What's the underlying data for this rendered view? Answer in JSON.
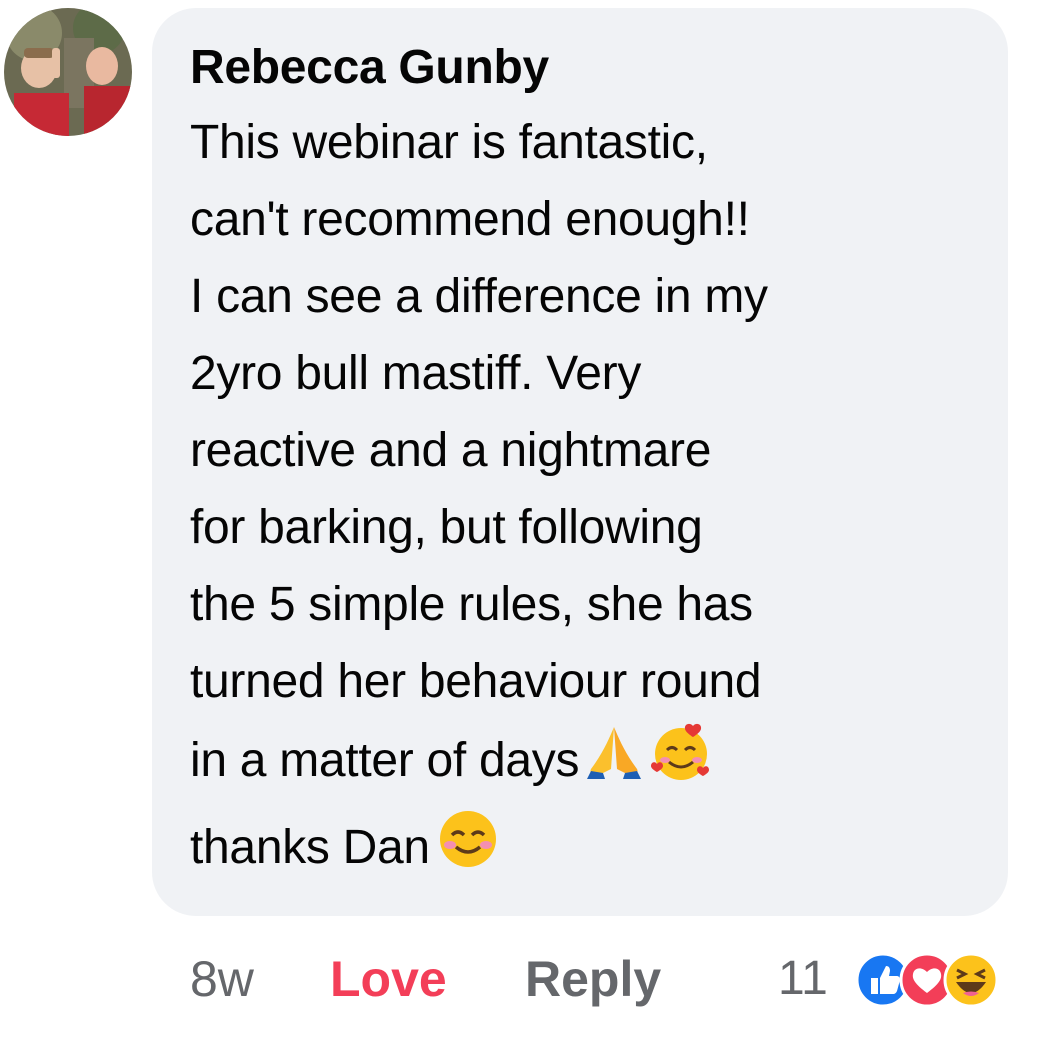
{
  "comment": {
    "author": "Rebecca Gunby",
    "lines": [
      "This webinar is fantastic,",
      "can't recommend enough!!",
      "I can see a difference in my",
      "2yro bull mastiff. Very",
      "reactive and a nightmare",
      "for barking, but following",
      "the 5 simple rules, she has",
      "turned her behaviour round",
      "in a matter of days",
      "thanks Dan"
    ],
    "emojis": [
      "folded-hands",
      "smiling-face-with-hearts",
      "smiling-face-with-smiling-eyes"
    ]
  },
  "actions": {
    "time": "8w",
    "love_label": "Love",
    "reply_label": "Reply"
  },
  "reactions": {
    "count": "11",
    "icons": [
      "like-icon",
      "love-icon",
      "haha-icon"
    ]
  },
  "colors": {
    "bubble": "#f0f2f5",
    "love": "#f33e58",
    "like": "#1877f2",
    "muted": "#65676b"
  }
}
